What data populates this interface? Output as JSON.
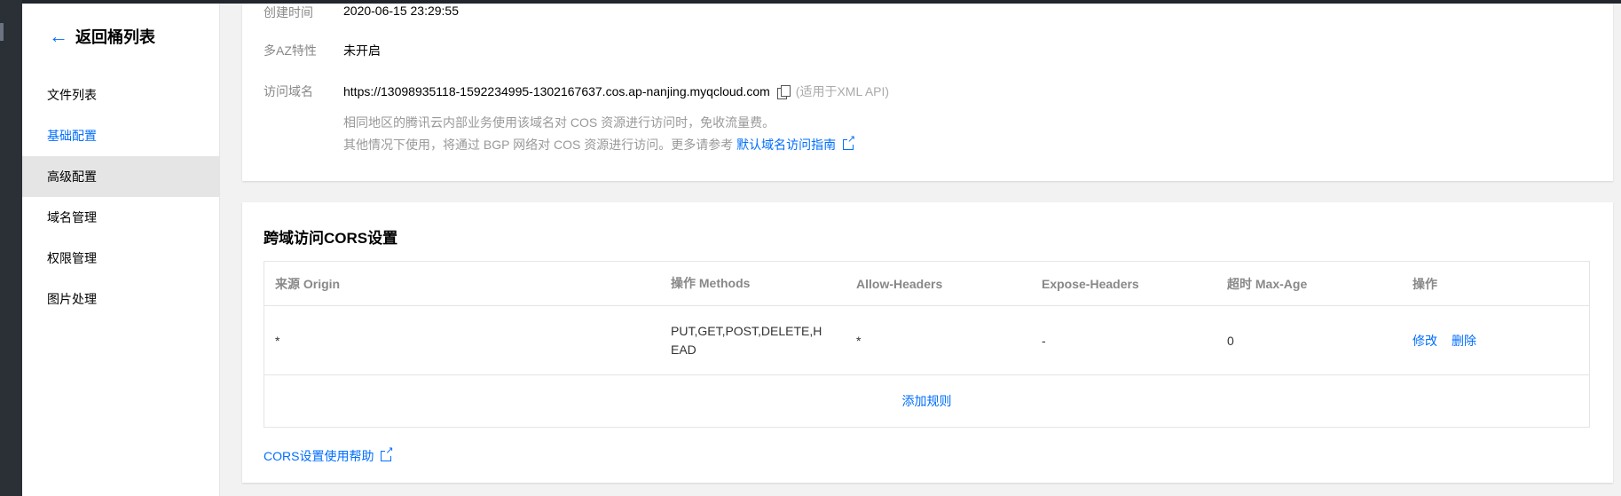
{
  "sidebar": {
    "back_label": "返回桶列表",
    "items": [
      {
        "label": "文件列表"
      },
      {
        "label": "基础配置"
      },
      {
        "label": "高级配置"
      },
      {
        "label": "域名管理"
      },
      {
        "label": "权限管理"
      },
      {
        "label": "图片处理"
      }
    ]
  },
  "overview": {
    "created_label": "创建时间",
    "created_value": "2020-06-15 23:29:55",
    "maz_label": "多AZ特性",
    "maz_value": "未开启",
    "domain_label": "访问域名",
    "domain_value": "https://13098935118-1592234995-1302167637.cos.ap-nanjing.myqcloud.com",
    "domain_hint": "(适用于XML API)",
    "desc_line1": "相同地区的腾讯云内部业务使用该域名对 COS 资源进行访问时，免收流量费。",
    "desc_line2": "其他情况下使用，将通过 BGP 网络对 COS 资源进行访问。更多请参考",
    "desc_link": "默认域名访问指南"
  },
  "cors": {
    "title": "跨域访问CORS设置",
    "columns": [
      "来源 Origin",
      "操作 Methods",
      "Allow-Headers",
      "Expose-Headers",
      "超时 Max-Age",
      "操作"
    ],
    "row": {
      "origin": "*",
      "methods_line1": "PUT,GET,POST,DELETE,H",
      "methods_line2": "EAD",
      "allow_headers": "*",
      "expose_headers": "-",
      "max_age": "0",
      "edit": "修改",
      "delete": "删除"
    },
    "add_rule": "添加规则",
    "help_link": "CORS设置使用帮助"
  },
  "colors": {
    "accent": "#006eff",
    "active_bg": "#e5e5e5"
  }
}
